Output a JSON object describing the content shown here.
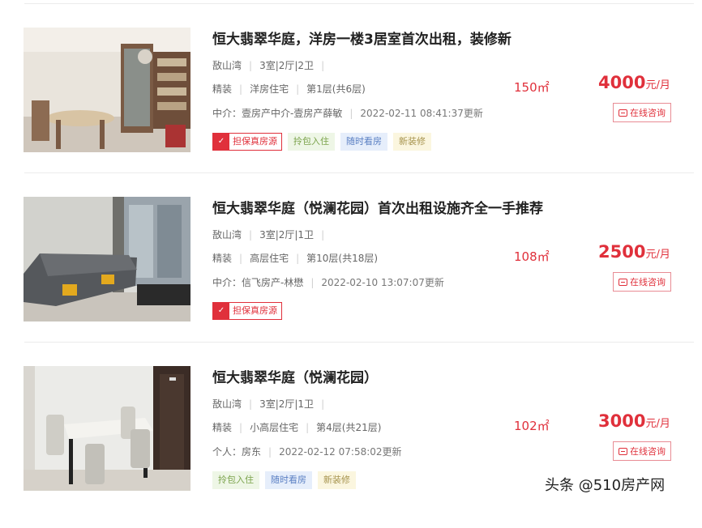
{
  "listings": [
    {
      "title": "恒大翡翠华庭，洋房一楼3居室首次出租，装修新",
      "district": "敔山湾",
      "layout": "3室|2厅|2卫",
      "decoration": "精装",
      "house_type": "洋房住宅",
      "floor": "第1层(共6层)",
      "agent_prefix": "中介：",
      "agent": "壹房产中介-壹房产薛敏",
      "updated": "2022-02-11 08:41:37更新",
      "area": "150㎡",
      "price": "4000",
      "price_unit": "元/月",
      "consult_label": "在线咨询",
      "verified_tag": "担保真房源",
      "tags": [
        "拎包入住",
        "随时看房",
        "新装修"
      ]
    },
    {
      "title": "恒大翡翠华庭（悦澜花园）首次出租设施齐全一手推荐",
      "district": "敔山湾",
      "layout": "3室|2厅|1卫",
      "decoration": "精装",
      "house_type": "高层住宅",
      "floor": "第10层(共18层)",
      "agent_prefix": "中介：",
      "agent": "信飞房产-林懋",
      "updated": "2022-02-10 13:07:07更新",
      "area": "108㎡",
      "price": "2500",
      "price_unit": "元/月",
      "consult_label": "在线咨询",
      "verified_tag": "担保真房源",
      "tags": []
    },
    {
      "title": "恒大翡翠华庭（悦澜花园）",
      "district": "敔山湾",
      "layout": "3室|2厅|1卫",
      "decoration": "精装",
      "house_type": "小高层住宅",
      "floor": "第4层(共21层)",
      "agent_prefix": "个人：",
      "agent": "房东",
      "updated": "2022-02-12 07:58:02更新",
      "area": "102㎡",
      "price": "3000",
      "price_unit": "元/月",
      "consult_label": "在线咨询",
      "tags": [
        "拎包入住",
        "随时看房",
        "新装修"
      ]
    }
  ],
  "watermark": "头条 @510房产网",
  "colors": {
    "price_red": "#e0303b",
    "tag_green": "#7aa24a",
    "tag_blue": "#5b80c3",
    "tag_yellow": "#a7944f"
  }
}
